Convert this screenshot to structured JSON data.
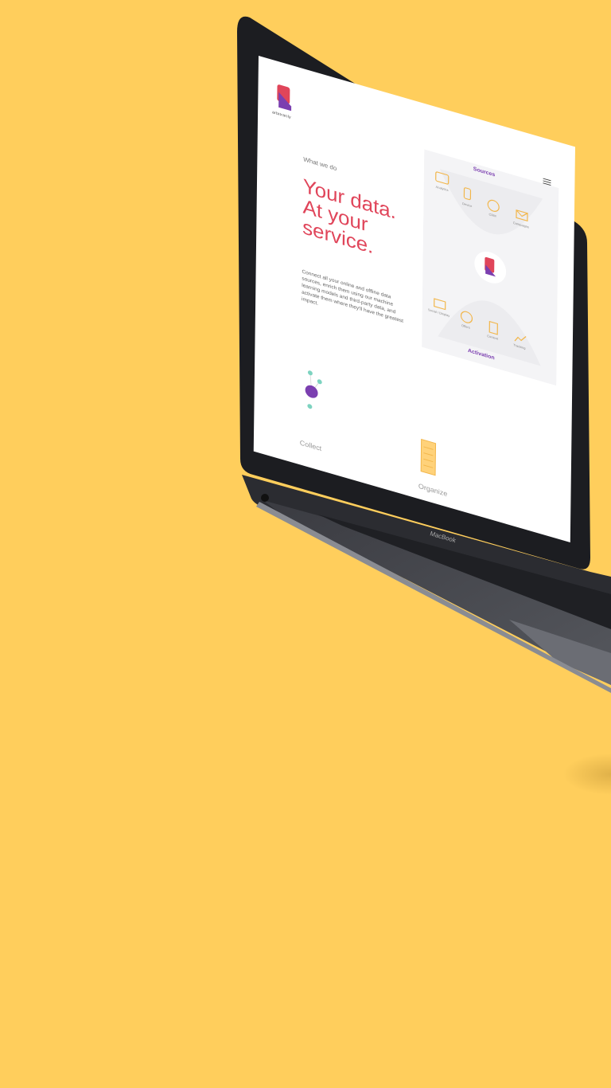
{
  "colors": {
    "background": "#ffce5c",
    "headline": "#e0455a",
    "accent_purple": "#7b3fb0",
    "icon_orange": "#f2b64a",
    "laptop_body": "#2b2c31"
  },
  "device": {
    "brand_label": "MacBook"
  },
  "site": {
    "brand_name": "arbitrarily",
    "eyebrow": "What we do",
    "headline": [
      "Your data.",
      "At your",
      "service."
    ],
    "body": "Connect all your online and offline data sources, enrich them using our machine learning models and third-party data, and activate them where they'll have the greatest impact.",
    "menu_icon": "hamburger-icon",
    "diagram": {
      "sources_label": "Sources",
      "activation_label": "Activation",
      "source_items": [
        "Analytics",
        "Device",
        "CRM",
        "Campaigns"
      ],
      "activation_items": [
        "Social / Display",
        "Offers",
        "Content",
        "Tracking"
      ]
    },
    "cut_labels": [
      "Collect",
      "Organize"
    ]
  }
}
